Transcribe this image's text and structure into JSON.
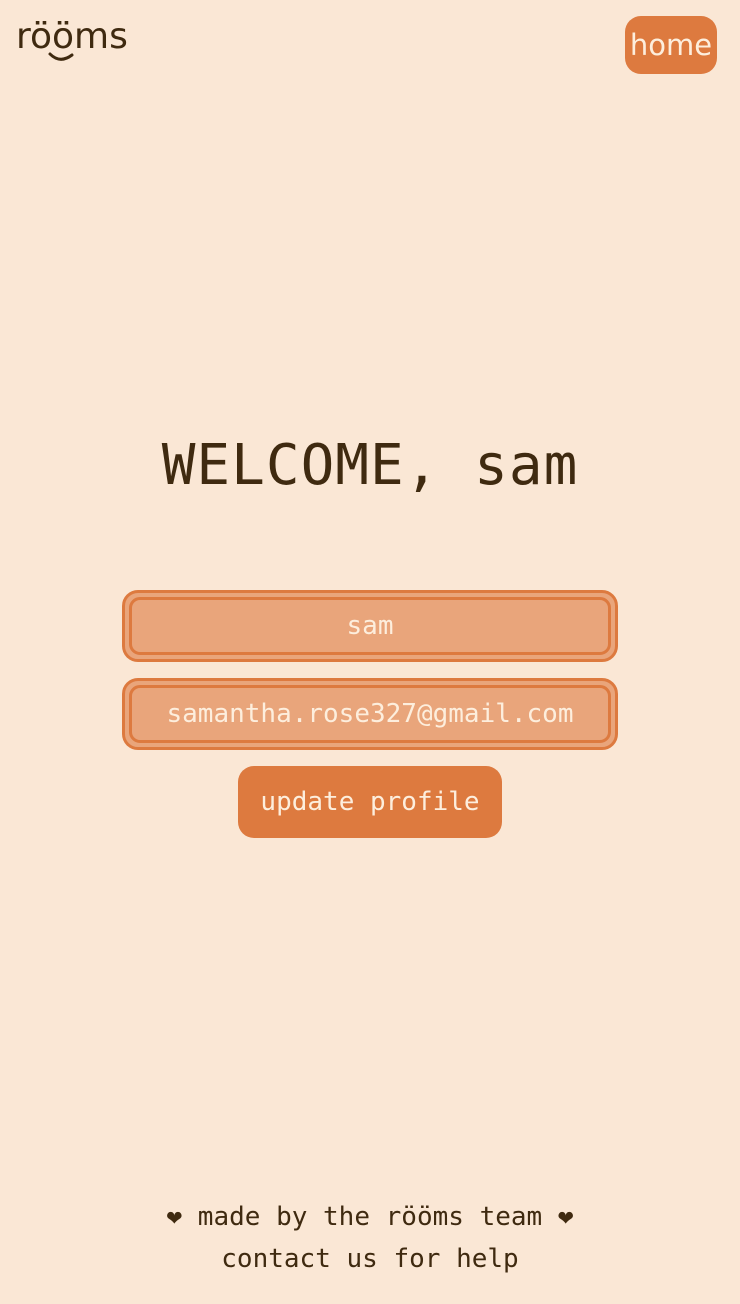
{
  "header": {
    "logo_text": "rööms",
    "home_label": "home"
  },
  "main": {
    "welcome_text": "WELCOME, sam",
    "name_value": "sam",
    "email_value": "samantha.rose327@gmail.com",
    "update_label": "update profile"
  },
  "footer": {
    "made_by": "❤ made by the rööms team ❤",
    "contact": "contact us for help"
  },
  "colors": {
    "background": "#fae7d5",
    "accent": "#dd7a3f",
    "field_fill": "#e9a57b",
    "text_dark": "#3f2a10",
    "text_light": "#fdeedd"
  }
}
